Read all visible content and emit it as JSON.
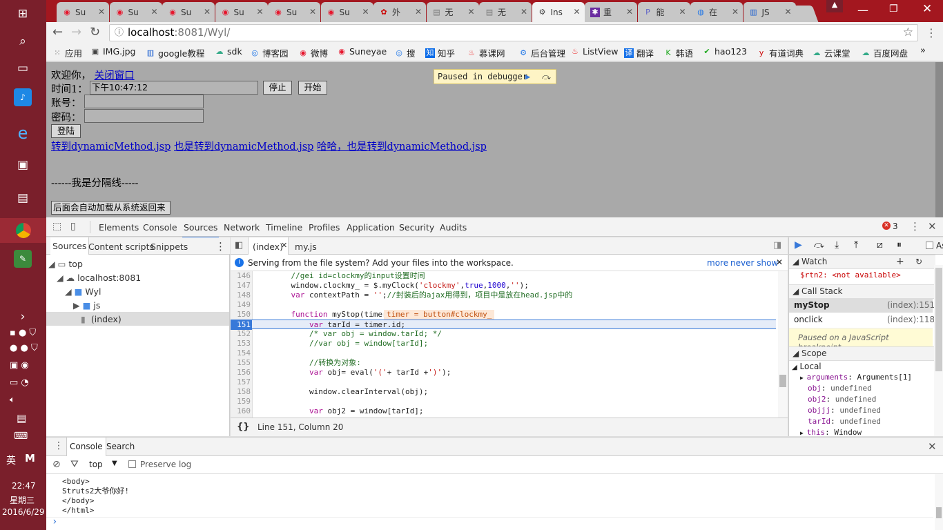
{
  "taskbar": {
    "lang": "英",
    "ime": "M",
    "time": "22:47",
    "weekday": "星期三",
    "date": "2016/6/29"
  },
  "browser": {
    "tabs": [
      {
        "label": "Su",
        "icon": "weibo-icon"
      },
      {
        "label": "Su",
        "icon": "weibo-icon"
      },
      {
        "label": "Su",
        "icon": "weibo-icon"
      },
      {
        "label": "Su",
        "icon": "weibo-icon"
      },
      {
        "label": "Su",
        "icon": "weibo-icon"
      },
      {
        "label": "Su",
        "icon": "weibo-icon"
      },
      {
        "label": "外",
        "icon": "fox-icon"
      },
      {
        "label": "无",
        "icon": "page-icon"
      },
      {
        "label": "无",
        "icon": "page-icon"
      },
      {
        "label": "Ins",
        "icon": "devtools-icon",
        "active": true
      },
      {
        "label": "重",
        "icon": "paw-icon"
      },
      {
        "label": "能",
        "icon": "php-icon"
      },
      {
        "label": "在",
        "icon": "chrome-icon"
      },
      {
        "label": "JS",
        "icon": "book-icon"
      }
    ],
    "url_host": "localhost",
    "url_rest": ":8081/Wyl/",
    "bookmarks": [
      {
        "label": "应用",
        "icon": "apps-icon"
      },
      {
        "label": "IMG.jpg",
        "icon": "image-icon"
      },
      {
        "label": "google教程",
        "icon": "book-icon"
      },
      {
        "label": "sdk",
        "icon": "cloud-icon"
      },
      {
        "label": "博客园",
        "icon": "blog-icon"
      },
      {
        "label": "微博",
        "icon": "weibo-icon"
      },
      {
        "label": "Suneyae",
        "icon": "weibo-icon"
      },
      {
        "label": "搜",
        "icon": "search-icon"
      },
      {
        "label": "知乎",
        "icon": "zhihu-icon"
      },
      {
        "label": "慕课网",
        "icon": "fire-icon"
      },
      {
        "label": "后台管理",
        "icon": "gear-icon"
      },
      {
        "label": "ListView",
        "icon": "fire-icon"
      },
      {
        "label": "翻译",
        "icon": "translate-icon"
      },
      {
        "label": "韩语",
        "icon": "kr-icon"
      },
      {
        "label": "hao123",
        "icon": "check-icon"
      },
      {
        "label": "有道词典",
        "icon": "youdao-icon"
      },
      {
        "label": "云课堂",
        "icon": "cloud-icon"
      },
      {
        "label": "百度网盘",
        "icon": "cloud-icon"
      }
    ],
    "more": "»"
  },
  "page": {
    "welcome": "欢迎你，",
    "close_link": "关闭窗口",
    "time_label": "时间1：",
    "time_value": "下午10:47:12",
    "stop_btn": "停止",
    "start_btn": "开始",
    "account_label": "账号：",
    "password_label": "密码：",
    "login_btn": "登陆",
    "links": [
      "转到dynamicMethod.jsp",
      "也是转到dynamicMethod.jsp",
      "哈哈，也是转到dynamicMethod.jsp"
    ],
    "divider": "------我是分隔线-----",
    "auto_btn": "后面会自动加载从系统返回来",
    "paused_label": "Paused in debugger"
  },
  "devtools": {
    "tabs": [
      "Elements",
      "Console",
      "Sources",
      "Network",
      "Timeline",
      "Profiles",
      "Application",
      "Security",
      "Audits"
    ],
    "active_tab": "Sources",
    "error_count": "3",
    "nav_tabs": [
      "Sources",
      "Content scripts",
      "Snippets"
    ],
    "tree": [
      {
        "label": "top",
        "icon": "frame-icon"
      },
      {
        "label": "localhost:8081",
        "icon": "cloud-icon"
      },
      {
        "label": "Wyl",
        "icon": "folder-icon"
      },
      {
        "label": "js",
        "icon": "folder-icon"
      },
      {
        "label": "(index)",
        "icon": "file-icon"
      }
    ],
    "editor_tabs": [
      "(index)",
      "my.js"
    ],
    "info": "Serving from the file system? Add your files into the workspace.",
    "info_more": "more",
    "info_never": "never show",
    "code": [
      {
        "n": "146",
        "t": "    //gei id=clockmy的input设置时间"
      },
      {
        "n": "147",
        "t": "    window.clockmy_ = $.myClock('clockmy',true,1000,'');"
      },
      {
        "n": "148",
        "t": "    var contextPath = '';//封装后的ajax用得到，项目中是放在head.jsp中的"
      },
      {
        "n": "149",
        "t": ""
      },
      {
        "n": "150",
        "t": "    function myStop(timer){"
      },
      {
        "n": "151",
        "t": "        var tarId = timer.id;"
      },
      {
        "n": "152",
        "t": "        /* var obj = window.tarId; */"
      },
      {
        "n": "153",
        "t": "        //var obj = window[tarId];"
      },
      {
        "n": "154",
        "t": ""
      },
      {
        "n": "155",
        "t": "        //转换为对象:"
      },
      {
        "n": "156",
        "t": "        var obj= eval('('+ tarId +')');"
      },
      {
        "n": "157",
        "t": ""
      },
      {
        "n": "158",
        "t": "        window.clearInterval(obj);"
      },
      {
        "n": "159",
        "t": ""
      },
      {
        "n": "160",
        "t": "        var obj2 = window[tarId];"
      }
    ],
    "inline_value": "timer = button#clockmy_",
    "status": "Line 151, Column 20",
    "watch_title": "Watch",
    "watch_item": "$rtn2: <not available>",
    "callstack_title": "Call Stack",
    "callstack": [
      {
        "fn": "myStop",
        "loc": "(index):151"
      },
      {
        "fn": "onclick",
        "loc": "(index):118"
      }
    ],
    "paused_msg": "Paused on a JavaScript breakpoint.",
    "scope_title": "Scope",
    "scope_local": "Local",
    "scope_vars": [
      {
        "k": "arguments",
        "v": "Arguments[1]"
      },
      {
        "k": "obj",
        "v": "undefined"
      },
      {
        "k": "obj2",
        "v": "undefined"
      },
      {
        "k": "objjj",
        "v": "undefined"
      },
      {
        "k": "tarId",
        "v": "undefined"
      },
      {
        "k": "this",
        "v": "Window"
      }
    ],
    "drawer_tabs": [
      "Console",
      "Search"
    ],
    "context": "top",
    "preserve_log": "Preserve log",
    "async_label": "As",
    "console_lines": [
      "<body>",
      "Struts2大爷你好!",
      "</body>",
      "</html>"
    ],
    "prompt": "›"
  }
}
